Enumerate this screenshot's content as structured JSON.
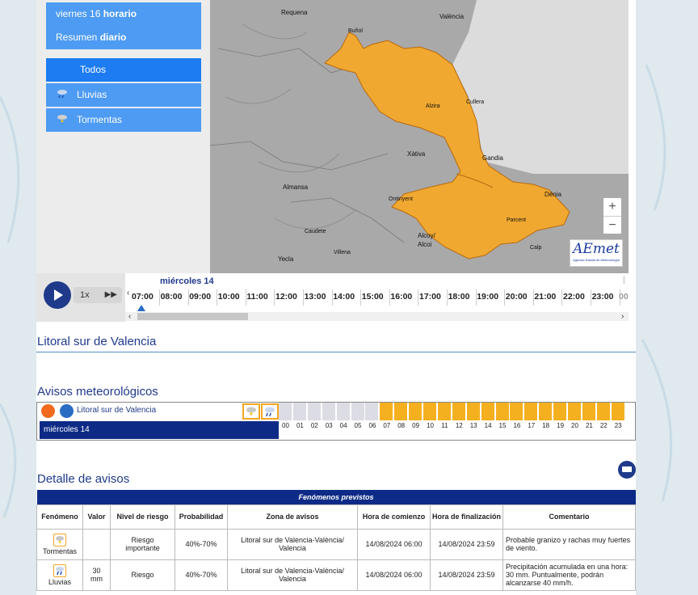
{
  "sidebar": {
    "buttons": [
      {
        "pre": "viernes 16 ",
        "bold": "horario"
      },
      {
        "pre": "Resumen ",
        "bold": "diario"
      }
    ],
    "filters": [
      {
        "label": "Todos",
        "icon": "none"
      },
      {
        "label": "Lluvias",
        "icon": "rain-icon"
      },
      {
        "label": "Tormentas",
        "icon": "storm-icon"
      }
    ]
  },
  "map": {
    "cities": [
      "Requena",
      "València",
      "Buñol",
      "Alzira",
      "Cullera",
      "Xàtiva",
      "Gandia",
      "Almansa",
      "Ontinyent",
      "Dénia",
      "Parcent",
      "Caudete",
      "Alcoy/",
      "Alcoi",
      "Villena",
      "Yecla",
      "Calp"
    ],
    "warning_color": "#f0a830",
    "zoom_in": "+",
    "zoom_out": "−",
    "logo_text": "AEmet",
    "logo_sub": "Agencia Estatal de Meteorología"
  },
  "player": {
    "speed": "1x",
    "day": "miércoles 14",
    "hours": [
      "07:00",
      "08:00",
      "09:00",
      "10:00",
      "11:00",
      "12:00",
      "13:00",
      "14:00",
      "15:00",
      "16:00",
      "17:00",
      "18:00",
      "19:00",
      "20:00",
      "21:00",
      "22:00",
      "23:00"
    ],
    "partial_hour": "00"
  },
  "region": {
    "title": "Litoral sur de Valencia"
  },
  "avisos": {
    "heading": "Avisos meteorológicos",
    "zone": "Litoral sur de Valencia",
    "day": "miércoles 14",
    "hours": [
      "00",
      "01",
      "02",
      "03",
      "04",
      "05",
      "06",
      "07",
      "08",
      "09",
      "10",
      "11",
      "12",
      "13",
      "14",
      "15",
      "16",
      "17",
      "18",
      "19",
      "20",
      "21",
      "22",
      "23"
    ],
    "active_from_hour": 7,
    "colors": {
      "active": "#f5b020",
      "inactive": "#dcdce4"
    }
  },
  "detalle": {
    "heading": "Detalle de avisos",
    "table_title": "Fenómenos previstos",
    "columns": [
      "Fenómeno",
      "Valor",
      "Nivel de riesgo",
      "Probabilidad",
      "Zona de avisos",
      "Hora de comienzo",
      "Hora de finalización",
      "Comentario"
    ],
    "rows": [
      {
        "fenomeno": "Tormentas",
        "valor": "",
        "nivel": "Riesgo importante",
        "prob": "40%-70%",
        "zona": "Litoral sur de Valencia-València/ Valencia",
        "inicio": "14/08/2024 06:00",
        "fin": "14/08/2024 23:59",
        "comentario": "Probable granizo y rachas muy fuertes de viento."
      },
      {
        "fenomeno": "Lluvias",
        "valor": "30 mm",
        "nivel": "Riesgo",
        "prob": "40%-70%",
        "zona": "Litoral sur de Valencia-València/ Valencia",
        "inicio": "14/08/2024 06:00",
        "fin": "14/08/2024 23:59",
        "comentario": "Precipitación acumulada en una hora: 30 mm. Puntualmente, podrán alcanzarse 40 mm/h."
      }
    ]
  }
}
